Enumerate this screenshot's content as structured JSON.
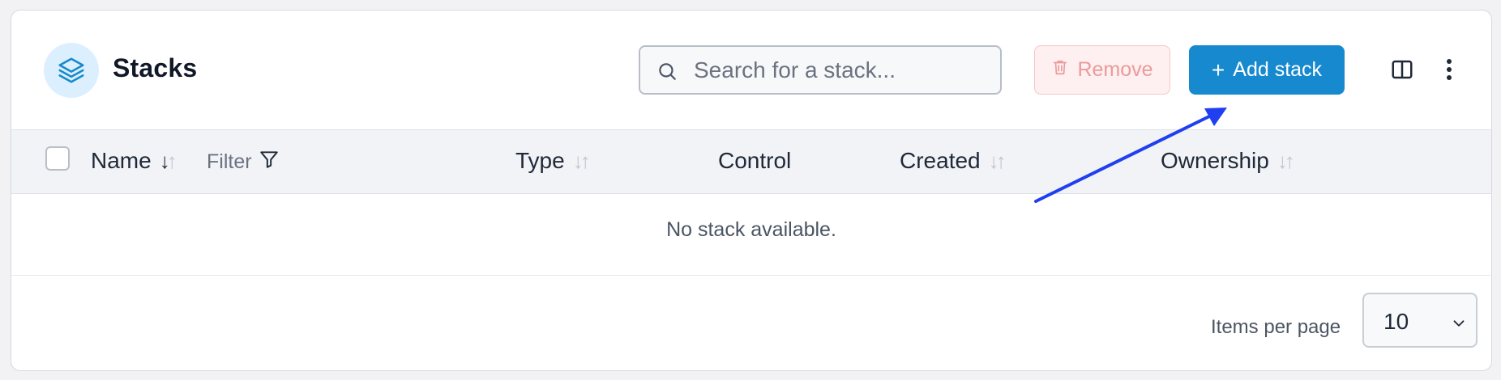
{
  "header": {
    "title": "Stacks",
    "title_icon": "layers-icon",
    "search": {
      "placeholder": "Search for a stack...",
      "value": ""
    },
    "remove_label": "Remove",
    "add_label": "Add stack",
    "add_prefix": "+"
  },
  "table": {
    "columns": [
      {
        "label": "Name",
        "sortable": true,
        "sort": "desc"
      },
      {
        "label": "Type",
        "sortable": true
      },
      {
        "label": "Control",
        "sortable": false
      },
      {
        "label": "Created",
        "sortable": true
      },
      {
        "label": "Ownership",
        "sortable": true
      }
    ],
    "filter_label": "Filter",
    "empty_message": "No stack available."
  },
  "footer": {
    "items_per_page_label": "Items per page",
    "items_per_page_value": "10"
  },
  "colors": {
    "accent": "#1689cf",
    "remove_text": "#ec9a9a",
    "annotation_arrow": "#1f3ff0"
  }
}
